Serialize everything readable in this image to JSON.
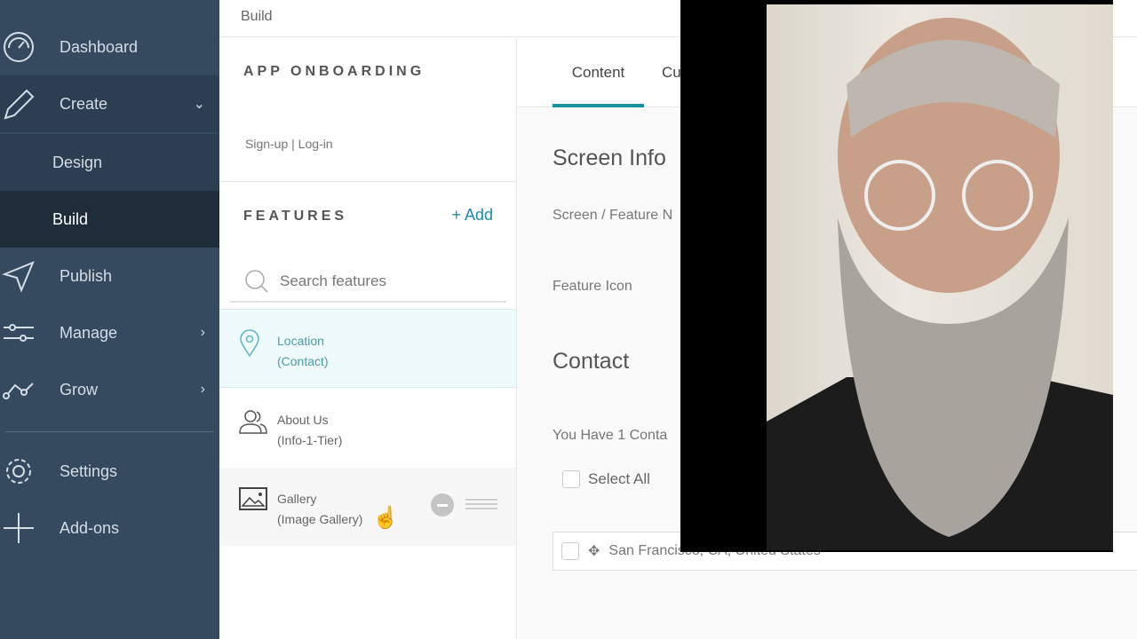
{
  "sidebar": {
    "items": [
      {
        "label": "Dashboard",
        "icon": "gauge-icon"
      },
      {
        "label": "Create",
        "icon": "pencil-icon",
        "expanded": true
      },
      {
        "label": "Design"
      },
      {
        "label": "Build",
        "active": true
      },
      {
        "label": "Publish",
        "icon": "paper-plane-icon"
      },
      {
        "label": "Manage",
        "icon": "sliders-icon"
      },
      {
        "label": "Grow",
        "icon": "growth-icon"
      },
      {
        "label": "Settings",
        "icon": "gear-icon"
      },
      {
        "label": "Add-ons",
        "icon": "plus-icon"
      }
    ]
  },
  "breadcrumb": "Build",
  "app": {
    "title": "APP ONBOARDING",
    "subtitle": "Sign-up | Log-in"
  },
  "features": {
    "title": "FEATURES",
    "add_label": "+ Add",
    "search_placeholder": "Search features",
    "items": [
      {
        "name": "Location",
        "type": "(Contact)",
        "icon": "map-pin-icon",
        "selected": true
      },
      {
        "name": "About Us",
        "type": "(Info-1-Tier)",
        "icon": "users-icon"
      },
      {
        "name": "Gallery",
        "type": "(Image Gallery)",
        "icon": "image-icon",
        "hovered": true
      }
    ]
  },
  "tabs": [
    "Content",
    "Cu"
  ],
  "content": {
    "screen_info": "Screen Info",
    "screen_feature_label": "Screen / Feature N",
    "feature_icon_label": "Feature Icon",
    "contact_title": "Contact",
    "contact_count": "You Have 1 Conta",
    "select_all": "Select All",
    "contact_item": "San Francisco, CA, United States"
  },
  "colors": {
    "sidebar": "#354a5f",
    "sidebar_active": "#1f2d3b",
    "accent": "#1a8fa8",
    "selected_row": "#eefafc"
  }
}
